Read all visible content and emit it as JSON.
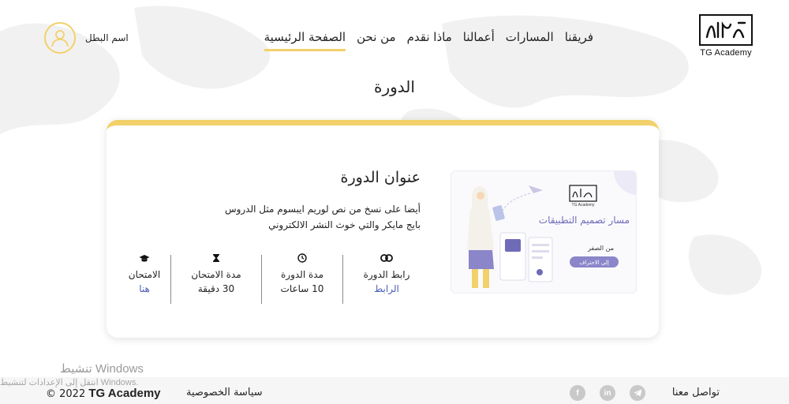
{
  "header": {
    "logo_text": "TG Academy",
    "nav": [
      {
        "label": "الصفحة الرئيسية",
        "active": true
      },
      {
        "label": "من نحن",
        "active": false
      },
      {
        "label": "ماذا نقدم",
        "active": false
      },
      {
        "label": "أعمالنا",
        "active": false
      },
      {
        "label": "المسارات",
        "active": false
      },
      {
        "label": "فريقنا",
        "active": false
      }
    ],
    "user_name": "اسم البطل"
  },
  "page_title": "الدورة",
  "course": {
    "title": "عنوان الدورة",
    "description": "أيضا على نسخ من نص لوريم ايبسوم مثل الدروس بايج مايكر والتي خوث النشر الالكتروني",
    "image": {
      "heading": "مسار تصميم التطبيقات",
      "sub": "من الصفر",
      "badge": "إلى الاحتراف"
    },
    "stats": [
      {
        "icon": "link-icon",
        "label": "رابط الدورة",
        "value": "الرابط",
        "link": true
      },
      {
        "icon": "clock-icon",
        "label": "مدة الدورة",
        "value": "10 ساعات",
        "link": false
      },
      {
        "icon": "hourglass-icon",
        "label": "مدة الامتحان",
        "value": "30 دقيقة",
        "link": false
      },
      {
        "icon": "graduation-cap-icon",
        "label": "الامتحان",
        "value": "هنا",
        "link": true
      }
    ]
  },
  "footer": {
    "contact": "تواصل معنا",
    "socials": [
      "facebook-icon",
      "linkedin-icon",
      "telegram-icon"
    ],
    "privacy": "سياسة الخصوصية",
    "copyright_brand": "TG Academy",
    "copyright_year": "© 2022"
  },
  "watermark": {
    "line1": "تنشيط Windows",
    "line2": "انتقل إلى الإعدادات لتنشيط Windows."
  },
  "colors": {
    "accent": "#f2d16b",
    "link": "#4a5eb7",
    "illustration_purple": "#6f6bb8"
  }
}
